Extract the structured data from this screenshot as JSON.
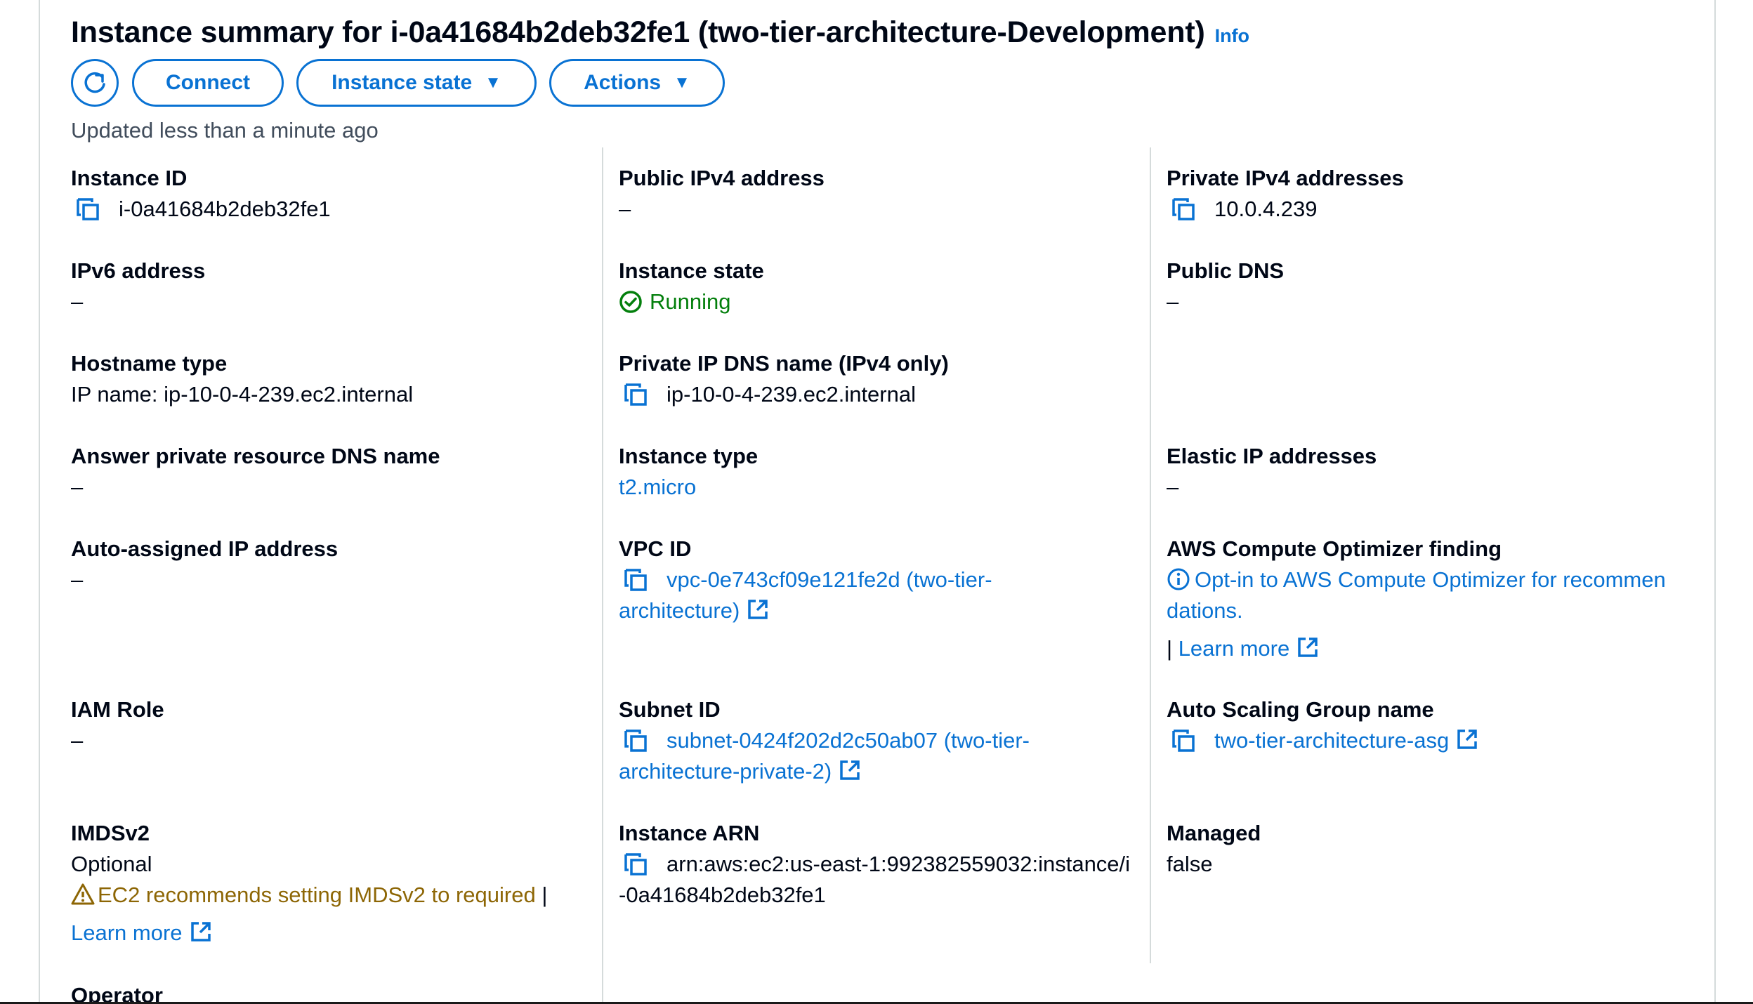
{
  "header": {
    "title": "Instance summary for i-0a41684b2deb32fe1 (two-tier-architecture-Development)",
    "info_link": "Info",
    "updated_text": "Updated less than a minute ago"
  },
  "toolbar": {
    "refresh_icon": "refresh-icon",
    "connect_label": "Connect",
    "instance_state_label": "Instance state",
    "actions_label": "Actions"
  },
  "fields": {
    "instance_id": {
      "label": "Instance ID",
      "value": "i-0a41684b2deb32fe1"
    },
    "public_ipv4": {
      "label": "Public IPv4 address",
      "value": "–"
    },
    "private_ipv4": {
      "label": "Private IPv4 addresses",
      "value": "10.0.4.239"
    },
    "ipv6": {
      "label": "IPv6 address",
      "value": "–"
    },
    "instance_state": {
      "label": "Instance state",
      "value": "Running"
    },
    "public_dns": {
      "label": "Public DNS",
      "value": "–"
    },
    "hostname_type": {
      "label": "Hostname type",
      "value": "IP name: ip-10-0-4-239.ec2.internal"
    },
    "private_ip_dns": {
      "label": "Private IP DNS name (IPv4 only)",
      "value": "ip-10-0-4-239.ec2.internal"
    },
    "answer_private_dns": {
      "label": "Answer private resource DNS name",
      "value": "–"
    },
    "instance_type": {
      "label": "Instance type",
      "value": "t2.micro"
    },
    "elastic_ip": {
      "label": "Elastic IP addresses",
      "value": "–"
    },
    "auto_assigned_ip": {
      "label": "Auto-assigned IP address",
      "value": "–"
    },
    "vpc_id": {
      "label": "VPC ID",
      "value_line1": "vpc-0e743cf09e121fe2d (two-tier-",
      "value_line2": "architecture)"
    },
    "compute_optimizer": {
      "label": "AWS Compute Optimizer finding",
      "line1": "Opt-in to AWS Compute Optimizer for recommen",
      "line2": "dations.",
      "separator": "|",
      "learn_more": "Learn more"
    },
    "iam_role": {
      "label": "IAM Role",
      "value": "–"
    },
    "subnet_id": {
      "label": "Subnet ID",
      "value_line1": "subnet-0424f202d2c50ab07 (two-tier-",
      "value_line2": "architecture-private-2)"
    },
    "asg_name": {
      "label": "Auto Scaling Group name",
      "value": "two-tier-architecture-asg"
    },
    "imdsv2": {
      "label": "IMDSv2",
      "value": "Optional",
      "warning": "EC2 recommends setting IMDSv2 to required",
      "separator": "|",
      "learn_more": "Learn more"
    },
    "instance_arn": {
      "label": "Instance ARN",
      "value_line1": "arn:aws:ec2:us-east-1:992382559032:instance/i",
      "value_line2": "-0a41684b2deb32fe1"
    },
    "managed": {
      "label": "Managed",
      "value": "false"
    },
    "operator": {
      "label": "Operator"
    }
  },
  "colors": {
    "link": "#0972d3",
    "success": "#037f0c",
    "warning": "#8d6605",
    "divider": "#d5dbdb"
  }
}
